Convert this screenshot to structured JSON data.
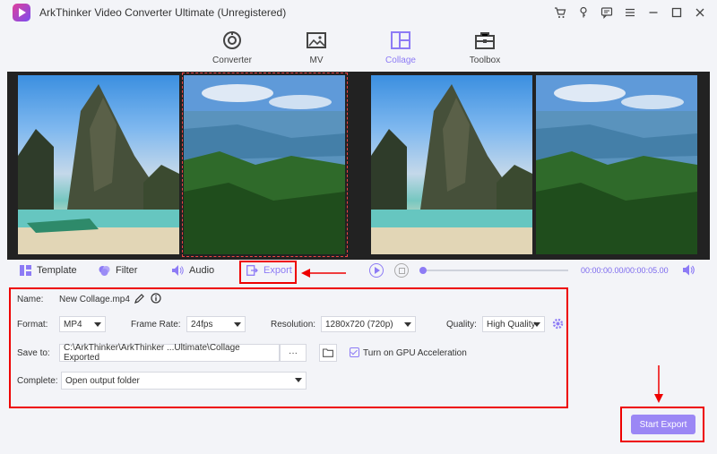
{
  "window": {
    "title": "ArkThinker Video Converter Ultimate (Unregistered)"
  },
  "nav": {
    "tabs": [
      {
        "label": "Converter",
        "icon": "converter-icon"
      },
      {
        "label": "MV",
        "icon": "mv-image-icon"
      },
      {
        "label": "Collage",
        "icon": "collage-grid-icon",
        "active": true
      },
      {
        "label": "Toolbox",
        "icon": "toolbox-icon"
      }
    ]
  },
  "toolbar": {
    "template": "Template",
    "filter": "Filter",
    "audio": "Audio",
    "export": "Export"
  },
  "player": {
    "time": "00:00:00.00/00:00:05.00",
    "progress": 0
  },
  "settings": {
    "name_label": "Name:",
    "name_value": "New Collage.mp4",
    "format_label": "Format:",
    "format_value": "MP4",
    "framerate_label": "Frame Rate:",
    "framerate_value": "24fps",
    "resolution_label": "Resolution:",
    "resolution_value": "1280x720 (720p)",
    "quality_label": "Quality:",
    "quality_value": "High Quality",
    "saveto_label": "Save to:",
    "saveto_value": "C:\\ArkThinker\\ArkThinker ...Ultimate\\Collage Exported",
    "browse_label": "···",
    "gpu_label": "Turn on GPU Acceleration",
    "gpu_checked": true,
    "complete_label": "Complete:",
    "complete_value": "Open output folder"
  },
  "actions": {
    "start_export": "Start Export"
  },
  "colors": {
    "accent": "#8d7bf5",
    "highlight_red": "#e00000"
  }
}
